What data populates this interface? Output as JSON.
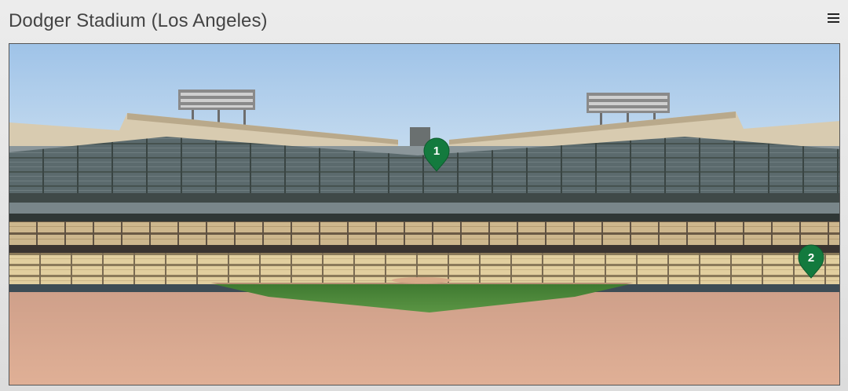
{
  "page": {
    "title": "Dodger Stadium (Los Angeles)",
    "menu_icon": "hamburger-menu-icon"
  },
  "viewer": {
    "hotspots": [
      {
        "label": "1",
        "icon": "map-pin-icon",
        "color": "#137a3e"
      },
      {
        "label": "2",
        "icon": "map-pin-icon",
        "color": "#137a3e"
      }
    ]
  },
  "colors": {
    "sky": "#b5d2ee",
    "dirt": "#d9a98a",
    "grass": "#4f8a3c",
    "seats_dark": "#4e5a5c",
    "seats_light": "#d9c79a",
    "pin": "#137a3e"
  }
}
